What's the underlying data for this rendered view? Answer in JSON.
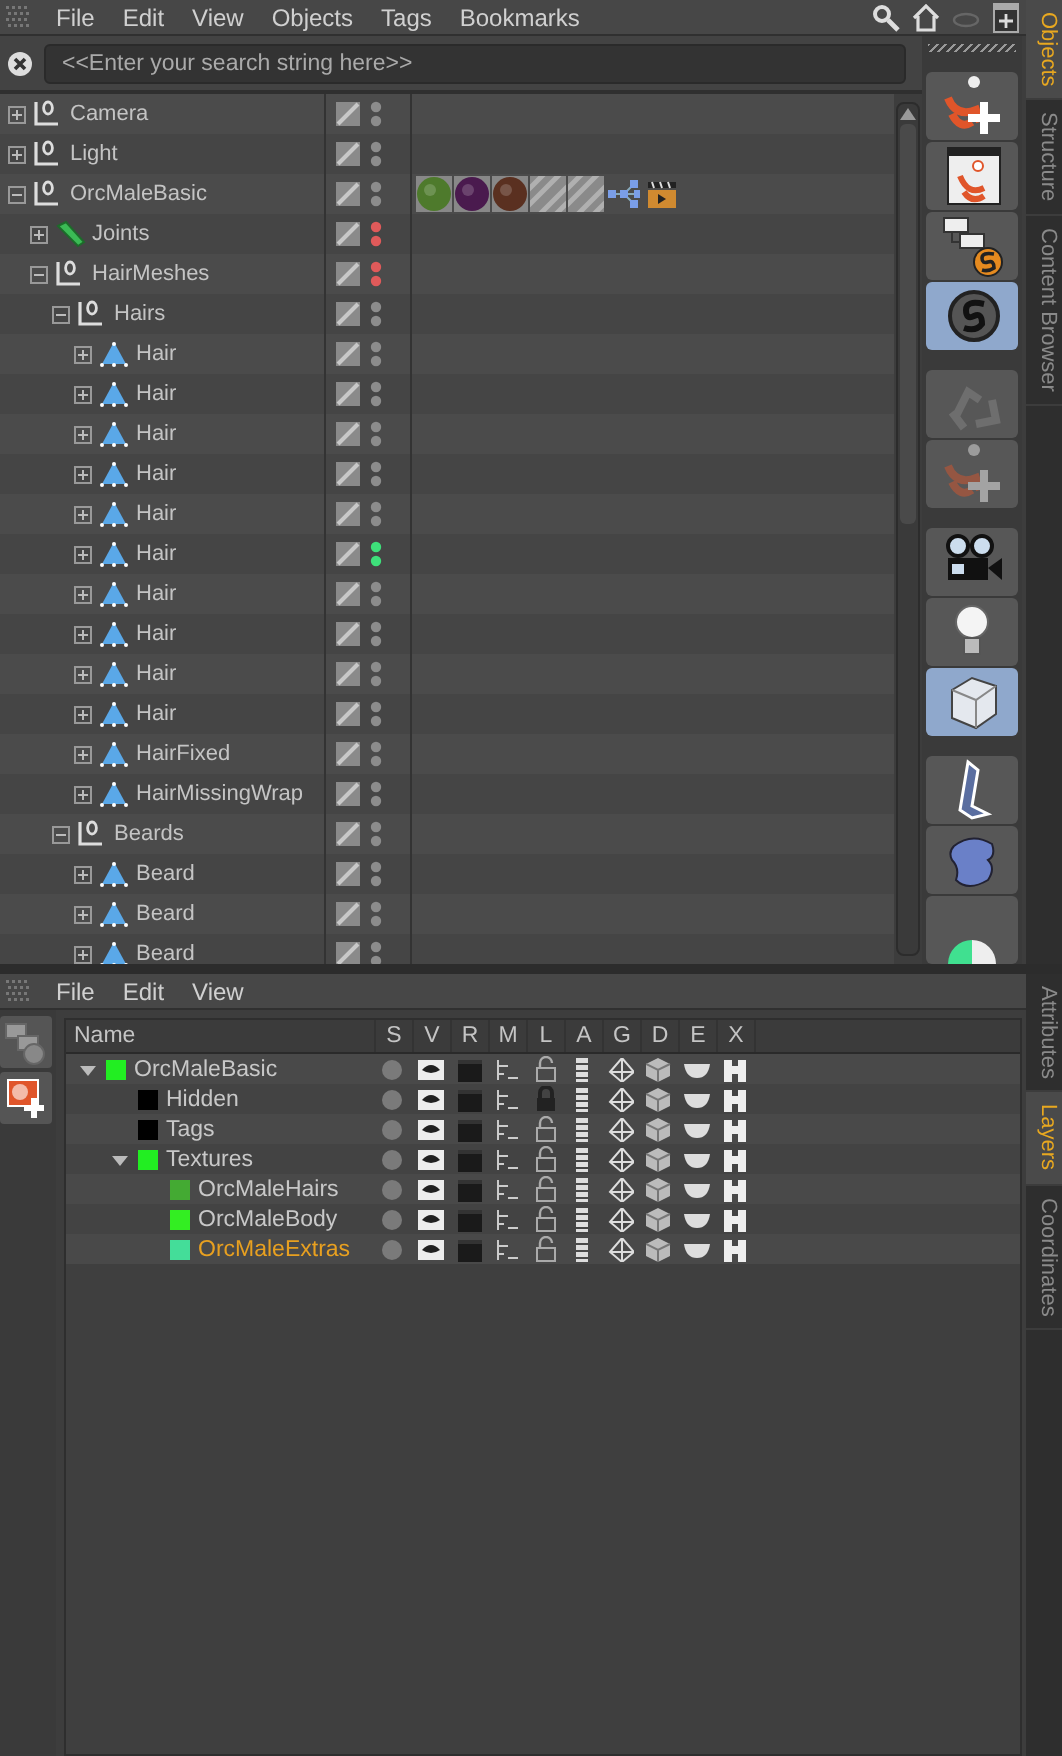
{
  "menu": [
    "File",
    "Edit",
    "View",
    "Objects",
    "Tags",
    "Bookmarks"
  ],
  "search": {
    "placeholder": "<<Enter your search string here>>"
  },
  "side_tabs": [
    {
      "label": "Objects",
      "selected": true
    },
    {
      "label": "Structure",
      "selected": false
    },
    {
      "label": "Content Browser",
      "selected": false
    }
  ],
  "objects": [
    {
      "name": "Camera",
      "kind": "null",
      "expanded": false,
      "color": "#8c8c8c"
    },
    {
      "name": "Light",
      "kind": "null",
      "expanded": false,
      "color": "#8c8c8c"
    },
    {
      "name": "OrcMaleBasic",
      "kind": "null",
      "expanded": true,
      "color": "#8c8c8c",
      "tags": [
        {
          "kind": "material",
          "color": "#4e7a2c"
        },
        {
          "kind": "material",
          "color": "#4a1a4e"
        },
        {
          "kind": "material",
          "color": "#5a3020"
        },
        {
          "kind": "hatch"
        },
        {
          "kind": "hatch"
        },
        {
          "kind": "graph"
        },
        {
          "kind": "clapper"
        }
      ],
      "children": [
        {
          "name": "Joints",
          "kind": "joint",
          "expanded": false,
          "color": "#e05a5a"
        },
        {
          "name": "HairMeshes",
          "kind": "null",
          "expanded": true,
          "color": "#e05a5a",
          "children": [
            {
              "name": "Hairs",
              "kind": "null",
              "expanded": true,
              "color": "#8c8c8c",
              "children": [
                {
                  "name": "Hair",
                  "kind": "hair",
                  "expanded": false,
                  "color": "#8c8c8c"
                },
                {
                  "name": "Hair",
                  "kind": "hair",
                  "expanded": false,
                  "color": "#8c8c8c"
                },
                {
                  "name": "Hair",
                  "kind": "hair",
                  "expanded": false,
                  "color": "#8c8c8c"
                },
                {
                  "name": "Hair",
                  "kind": "hair",
                  "expanded": false,
                  "color": "#8c8c8c"
                },
                {
                  "name": "Hair",
                  "kind": "hair",
                  "expanded": false,
                  "color": "#8c8c8c"
                },
                {
                  "name": "Hair",
                  "kind": "hair",
                  "expanded": false,
                  "color": "#3ee07a"
                },
                {
                  "name": "Hair",
                  "kind": "hair",
                  "expanded": false,
                  "color": "#8c8c8c"
                },
                {
                  "name": "Hair",
                  "kind": "hair",
                  "expanded": false,
                  "color": "#8c8c8c"
                },
                {
                  "name": "Hair",
                  "kind": "hair",
                  "expanded": false,
                  "color": "#8c8c8c"
                },
                {
                  "name": "Hair",
                  "kind": "hair",
                  "expanded": false,
                  "color": "#8c8c8c"
                },
                {
                  "name": "HairFixed",
                  "kind": "hair",
                  "expanded": false,
                  "color": "#8c8c8c"
                },
                {
                  "name": "HairMissingWrap",
                  "kind": "hair",
                  "expanded": false,
                  "color": "#8c8c8c"
                }
              ]
            },
            {
              "name": "Beards",
              "kind": "null",
              "expanded": true,
              "color": "#8c8c8c",
              "children": [
                {
                  "name": "Beard",
                  "kind": "hair",
                  "expanded": false,
                  "color": "#8c8c8c"
                },
                {
                  "name": "Beard",
                  "kind": "hair",
                  "expanded": false,
                  "color": "#8c8c8c"
                },
                {
                  "name": "Beard",
                  "kind": "hair",
                  "expanded": false,
                  "color": "#8c8c8c"
                }
              ]
            }
          ]
        }
      ]
    }
  ],
  "palette": [
    {
      "buttons": [
        {
          "kind": "add-figure",
          "selected": false,
          "disabled": false
        },
        {
          "kind": "figure-window",
          "selected": false,
          "disabled": false
        },
        {
          "kind": "hierarchy-s",
          "selected": false,
          "disabled": false
        },
        {
          "kind": "s-circle",
          "selected": true,
          "disabled": false
        }
      ]
    },
    {
      "buttons": [
        {
          "kind": "recycle",
          "selected": false,
          "disabled": true
        },
        {
          "kind": "add-figure",
          "selected": false,
          "disabled": true
        }
      ]
    },
    {
      "buttons": [
        {
          "kind": "camera",
          "selected": false,
          "disabled": false
        },
        {
          "kind": "bulb",
          "selected": false,
          "disabled": false
        },
        {
          "kind": "cube",
          "selected": true,
          "disabled": false
        }
      ]
    },
    {
      "buttons": [
        {
          "kind": "bone",
          "selected": false,
          "disabled": false
        },
        {
          "kind": "blob",
          "selected": false,
          "disabled": false
        },
        {
          "kind": "sphere",
          "selected": false,
          "disabled": false
        }
      ]
    }
  ],
  "layer_menu": [
    "File",
    "Edit",
    "View"
  ],
  "layer_tabs": [
    {
      "label": "Attributes",
      "selected": false
    },
    {
      "label": "Layers",
      "selected": true
    },
    {
      "label": "Coordinates",
      "selected": false
    }
  ],
  "layer_columns": [
    "Name",
    "S",
    "V",
    "R",
    "M",
    "L",
    "A",
    "G",
    "D",
    "E",
    "X"
  ],
  "layers": [
    {
      "name": "OrcMaleBasic",
      "color": "#22ee22",
      "expanded": true,
      "selected": false,
      "locked": false,
      "children": [
        {
          "name": "Hidden",
          "color": "#000000",
          "selected": false,
          "locked": true
        },
        {
          "name": "Tags",
          "color": "#000000",
          "selected": false,
          "locked": false
        },
        {
          "name": "Textures",
          "color": "#22ee22",
          "expanded": true,
          "selected": false,
          "locked": false,
          "children": [
            {
              "name": "OrcMaleHairs",
              "color": "#44aa33",
              "selected": false,
              "locked": false
            },
            {
              "name": "OrcMaleBody",
              "color": "#33ee22",
              "selected": false,
              "locked": false
            },
            {
              "name": "OrcMaleExtras",
              "color": "#44dd99",
              "selected": true,
              "locked": false
            }
          ]
        }
      ]
    }
  ]
}
